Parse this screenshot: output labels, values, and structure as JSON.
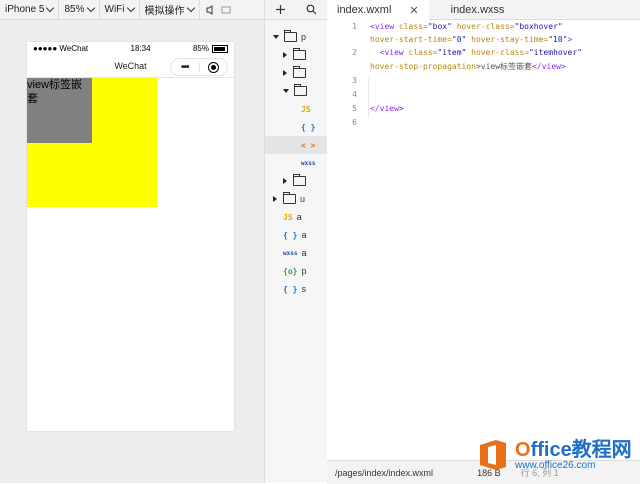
{
  "toolbar": {
    "device": "iPhone 5",
    "zoom": "85%",
    "network": "WiFi",
    "simulate": "模拟操作"
  },
  "phone": {
    "status": {
      "carrier": "●●●●● WeChat",
      "time": "18:34",
      "battery": "85%"
    },
    "nav_title": "WeChat",
    "capsule_menu": "•••",
    "item_text": "view标签嵌套"
  },
  "tree": {
    "root_label": "p",
    "u_label": "u",
    "files": [
      {
        "icon": "JS",
        "label": "a",
        "color": "#e0a800"
      },
      {
        "icon": "{ }",
        "label": "a",
        "color": "#1a73c8"
      },
      {
        "icon": "wxss",
        "label": "a",
        "color": "#1a4fa0"
      },
      {
        "icon": "{o}",
        "label": "p",
        "color": "#2a9d4a"
      },
      {
        "icon": "{ }",
        "label": "s",
        "color": "#1a73c8"
      }
    ],
    "page_files": [
      {
        "icon": "JS",
        "color": "#e0a800"
      },
      {
        "icon": "{ }",
        "color": "#1a73c8"
      },
      {
        "icon": "< >",
        "color": "#e07020"
      },
      {
        "icon": "wxss",
        "color": "#1a4fa0"
      }
    ]
  },
  "tabs": [
    {
      "label": "index.wxml",
      "close": "✕"
    },
    {
      "label": "index.wxss"
    }
  ],
  "code": {
    "line_numbers": [
      "1",
      "2",
      "3",
      "4",
      "5",
      "6"
    ],
    "l1a_tag": "<view",
    "l1a_attr1": " class=",
    "l1a_val1": "\"box\"",
    "l1a_attr2": " hover-class=",
    "l1a_val2": "\"boxhover\"",
    "l1b_attr1": "hover-start-time=",
    "l1b_val1": "\"0\"",
    "l1b_attr2": " hover-stay-time=",
    "l1b_val2": "\"10\"",
    "l1b_end": ">",
    "l2a_tag": "<view",
    "l2a_attr1": " class=",
    "l2a_val1": "\"item\"",
    "l2a_attr2": " hover-class=",
    "l2a_val2": "\"itemhover\"",
    "l2b_attr": "hover-stop-propagation",
    "l2b_text": ">view标签嵌套",
    "l2b_close": "</view>",
    "l5": "</view>"
  },
  "status": {
    "path": "/pages/index/index.wxml",
    "size": "186 B",
    "pos": "行 6, 列 1"
  },
  "watermark": {
    "brand_o": "O",
    "brand_rest": "ffice教程网",
    "site": "www.office26.com"
  }
}
